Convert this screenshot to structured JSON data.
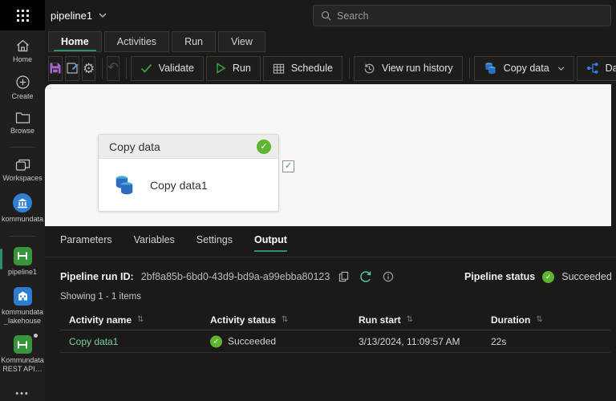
{
  "colors": {
    "success_green": "#5fb432",
    "accent_green": "#2e8e6d",
    "link_green": "#79cf9f",
    "icon_blue": "#2f83e0",
    "save_purple": "#a763c8",
    "canvas_bg": "#f7f7f7"
  },
  "topbar": {
    "app_title": "pipeline1",
    "search_placeholder": "Search"
  },
  "ribbon": {
    "tabs": [
      {
        "label": "Home",
        "active": true
      },
      {
        "label": "Activities",
        "active": false
      },
      {
        "label": "Run",
        "active": false
      },
      {
        "label": "View",
        "active": false
      }
    ],
    "buttons": {
      "validate": "Validate",
      "run": "Run",
      "schedule": "Schedule",
      "view_run_history": "View run history",
      "copy_data": "Copy data",
      "dataflow": "Dataflow"
    }
  },
  "sidebar": {
    "items": [
      {
        "label": "Home"
      },
      {
        "label": "Create"
      },
      {
        "label": "Browse"
      },
      {
        "label": "Workspaces"
      },
      {
        "label": "kommundata"
      },
      {
        "label": "pipeline1",
        "active": true
      },
      {
        "label": "kommundata_lakehouse"
      },
      {
        "label": "Kommundata REST API…"
      }
    ],
    "more": "•••"
  },
  "canvas": {
    "activity": {
      "type_label": "Copy data",
      "name": "Copy data1"
    }
  },
  "panel": {
    "tabs": [
      {
        "label": "Parameters",
        "active": false
      },
      {
        "label": "Variables",
        "active": false
      },
      {
        "label": "Settings",
        "active": false
      },
      {
        "label": "Output",
        "active": true
      }
    ],
    "run_id_label": "Pipeline run ID:",
    "run_id": "2bf8a85b-6bd0-43d9-bd9a-a99ebba80123",
    "status_label": "Pipeline status",
    "status_value": "Succeeded",
    "showing": "Showing 1 - 1 items",
    "table": {
      "columns": [
        "Activity name",
        "Activity status",
        "Run start",
        "Duration"
      ],
      "rows": [
        {
          "name": "Copy data1",
          "status": "Succeeded",
          "run_start": "3/13/2024, 11:09:57 AM",
          "duration": "22s"
        }
      ]
    }
  },
  "icons": {
    "gear": "⚙",
    "undo": "↶",
    "sort": "⇅",
    "check": "✓"
  }
}
